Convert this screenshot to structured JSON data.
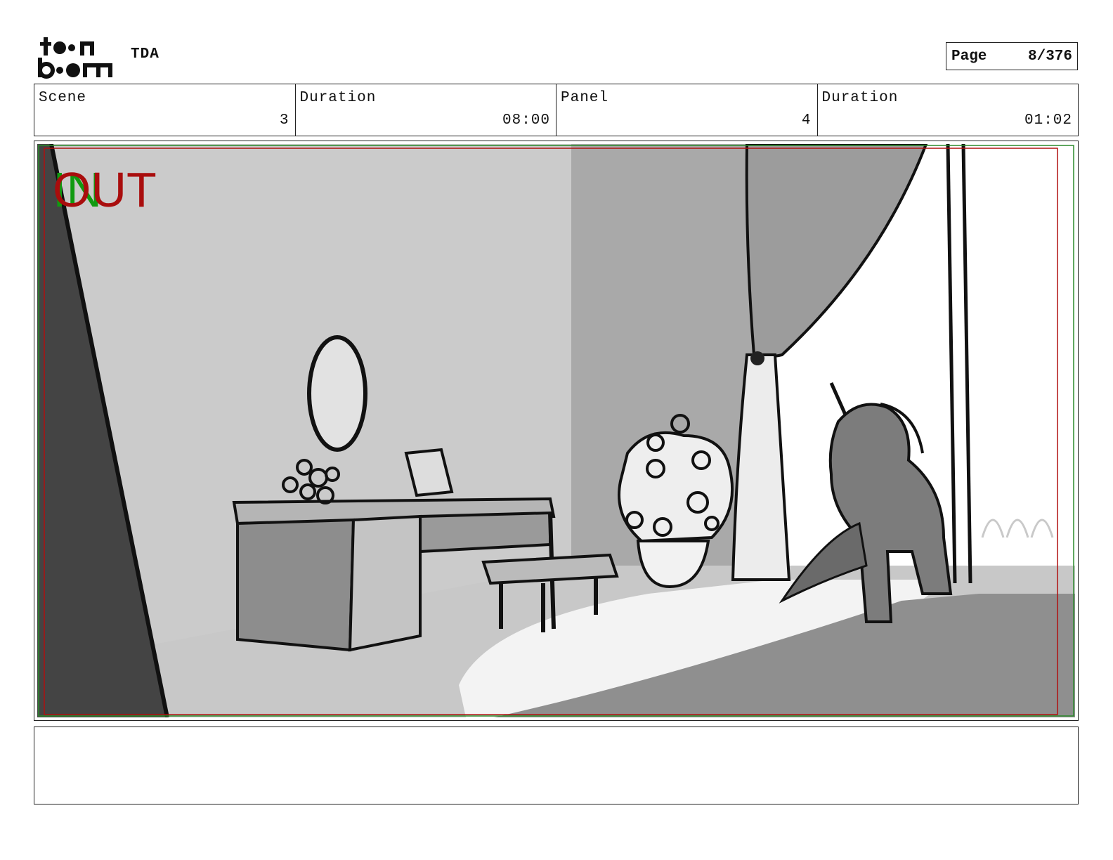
{
  "header": {
    "logo_text": "toon boom",
    "project": "TDA",
    "page_label": "Page",
    "page_number": "8/376"
  },
  "info": {
    "scene_label": "Scene",
    "scene_value": "3",
    "scene_duration_label": "Duration",
    "scene_duration_value": "08:00",
    "panel_label": "Panel",
    "panel_value": "4",
    "panel_duration_label": "Duration",
    "panel_duration_value": "01:02"
  },
  "frame": {
    "in_marker": "IN",
    "out_marker": "OUT",
    "colors": {
      "in": "#119a11",
      "out": "#a90d0d"
    }
  },
  "notes": {
    "text": ""
  }
}
